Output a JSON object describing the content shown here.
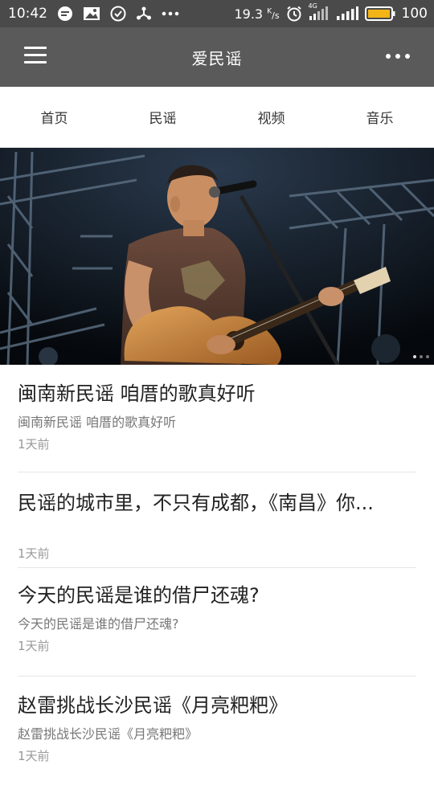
{
  "status_bar": {
    "time": "10:42",
    "network_speed": "19.3",
    "speed_unit_top": "K",
    "speed_unit_bottom": "/s",
    "network_type": "4G",
    "battery": "100",
    "icons": [
      "message-icon",
      "image-icon",
      "check-circle-icon",
      "share-icon",
      "more-notifications-icon",
      "alarm-icon",
      "signal-4g-icon",
      "signal-icon",
      "battery-icon"
    ]
  },
  "app_bar": {
    "title": "爱民谣",
    "menu_icon": "menu-icon",
    "more_icon": "more-icon"
  },
  "tabs": [
    "首页",
    "民谣",
    "视频",
    "音乐"
  ],
  "banner": {
    "image": "folk-singer-with-guitar",
    "slide_count": 3,
    "active_slide": 1
  },
  "articles": [
    {
      "title": "闽南新民谣 咱厝的歌真好听",
      "summary": "闽南新民谣 咱厝的歌真好听",
      "date": "1天前"
    },
    {
      "title": "民谣的城市里，不只有成都，《南昌》你...",
      "summary": "",
      "date": "1天前"
    },
    {
      "title": "今天的民谣是谁的借尸还魂?",
      "summary": "今天的民谣是谁的借尸还魂?",
      "date": "1天前"
    },
    {
      "title": "赵雷挑战长沙民谣《月亮粑粑》",
      "summary": "赵雷挑战长沙民谣《月亮粑粑》",
      "date": "1天前"
    }
  ],
  "colors": {
    "status_bar_bg": "#4a4a4a",
    "app_bar_bg": "#5a5a5a",
    "battery_fill": "#f3b416"
  }
}
